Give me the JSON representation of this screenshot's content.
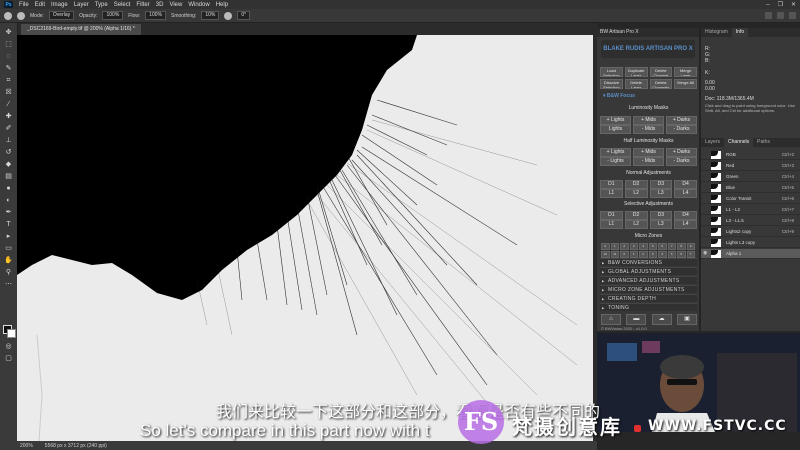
{
  "menubar": {
    "logo": "Ps",
    "items": [
      "File",
      "Edit",
      "Image",
      "Layer",
      "Type",
      "Select",
      "Filter",
      "3D",
      "View",
      "Window",
      "Help"
    ],
    "window_controls": [
      "–",
      "❐",
      "✕"
    ]
  },
  "options_bar": {
    "mode_label": "Mode:",
    "mode_value": "Overlay",
    "opacity_label": "Opacity:",
    "opacity_value": "100%",
    "flow_label": "Flow:",
    "flow_value": "100%",
    "smoothing_label": "Smoothing:",
    "smoothing_value": "10%",
    "angle_value": "0°"
  },
  "document": {
    "tab_title": "_DSC2169-Bird-empty.tif @ 200% (Alpha 1/16) *"
  },
  "statusbar": {
    "zoom": "200%",
    "doc_info": "5568 px x 3712 px (240 ppi)"
  },
  "ba_panel": {
    "header": "BW Artisan Pro X",
    "logo": "BLAKE RUDIS ARTISAN PRO X",
    "top_buttons_row1": [
      "Load Selection",
      "Duplicate Layer",
      "Delete Channel",
      "Merge Layer"
    ],
    "top_buttons_row2": [
      "Dissolve Selection",
      "Delete Layer",
      "Delete Channels",
      "Merge All"
    ],
    "bw_tag": "▾ B&W Focus",
    "luminosity_title": "Luminosity Masks",
    "lum_plus": [
      "+ Lights",
      "+ Mids",
      "+ Darks"
    ],
    "lum_minus": [
      "Lights",
      "- Mids",
      "- Darks"
    ],
    "half_title": "Half Luminosity Masks",
    "half_plus": [
      "+ Lights",
      "+ Mids",
      "+ Darks"
    ],
    "half_minus": [
      "- Lights",
      "- Mids",
      "- Darks"
    ],
    "normal_title": "Normal Adjustments",
    "normal_d": [
      "D1",
      "D2",
      "D3",
      "D4"
    ],
    "normal_l": [
      "L1",
      "L2",
      "L3",
      "L4"
    ],
    "selective_title": "Selective Adjustments",
    "selective_d": [
      "D1",
      "D2",
      "D3",
      "D4"
    ],
    "selective_l": [
      "L1",
      "L2",
      "L3",
      "L4"
    ],
    "micro_title": "Micro Zones",
    "zones": [
      "0",
      "1",
      "2",
      "3",
      "4",
      "5",
      "6",
      "7",
      "8",
      "9",
      "10",
      "11",
      "0",
      "1",
      "2",
      "3",
      "4",
      "5",
      "6",
      "7",
      "8",
      "9",
      "10",
      "11"
    ],
    "collapsed": [
      "B&W CONVERSIONS",
      "GLOBAL ADJUSTMENTS",
      "ADVANCED ADJUSTMENTS",
      "MICRO ZONE ADJUSTMENTS",
      "CREATING DEPTH",
      "TONING"
    ],
    "bottom_icons": [
      "⌂",
      "▬",
      "☁",
      "▣"
    ],
    "footer": "© BWVision 2020 - v1.0.0"
  },
  "info_panel": {
    "tabs": [
      "Histogram",
      "Info"
    ],
    "active_tab": "Info",
    "r": "R:",
    "g": "G:",
    "b": "B:",
    "k": "K:",
    "val1": "0.00",
    "val2": "0.00",
    "doc_label": "Doc: 118.3M/1365.4M",
    "help": "Click and drag to paint using foreground color. Use Shift, Alt, and Ctrl for additional options."
  },
  "channels_panel": {
    "tabs": [
      "Layers",
      "Channels",
      "Paths"
    ],
    "active_tab": "Channels",
    "rows": [
      {
        "name": "RGB",
        "shortcut": "Ctrl+2"
      },
      {
        "name": "Red",
        "shortcut": "Ctrl+3"
      },
      {
        "name": "Green",
        "shortcut": "Ctrl+4"
      },
      {
        "name": "Blue",
        "shortcut": "Ctrl+5"
      },
      {
        "name": "Color Transit",
        "shortcut": "Ctrl+6"
      },
      {
        "name": "L1 - L2",
        "shortcut": "Ctrl+7"
      },
      {
        "name": "L3 - L1.5",
        "shortcut": "Ctrl+8"
      },
      {
        "name": "Lights2 copy",
        "shortcut": "Ctrl+9"
      },
      {
        "name": "Lights L3 copy",
        "shortcut": ""
      },
      {
        "name": "Alpha 1",
        "shortcut": ""
      }
    ]
  },
  "subtitles": {
    "cn": "我们来比较一下这部分和这部分，看看是否有些不同的",
    "en": "So let's compare in this part now with t"
  },
  "watermark": {
    "logo": "FS",
    "cn": "梵摄创意库",
    "url": "WWW.FSTVC.CC"
  }
}
